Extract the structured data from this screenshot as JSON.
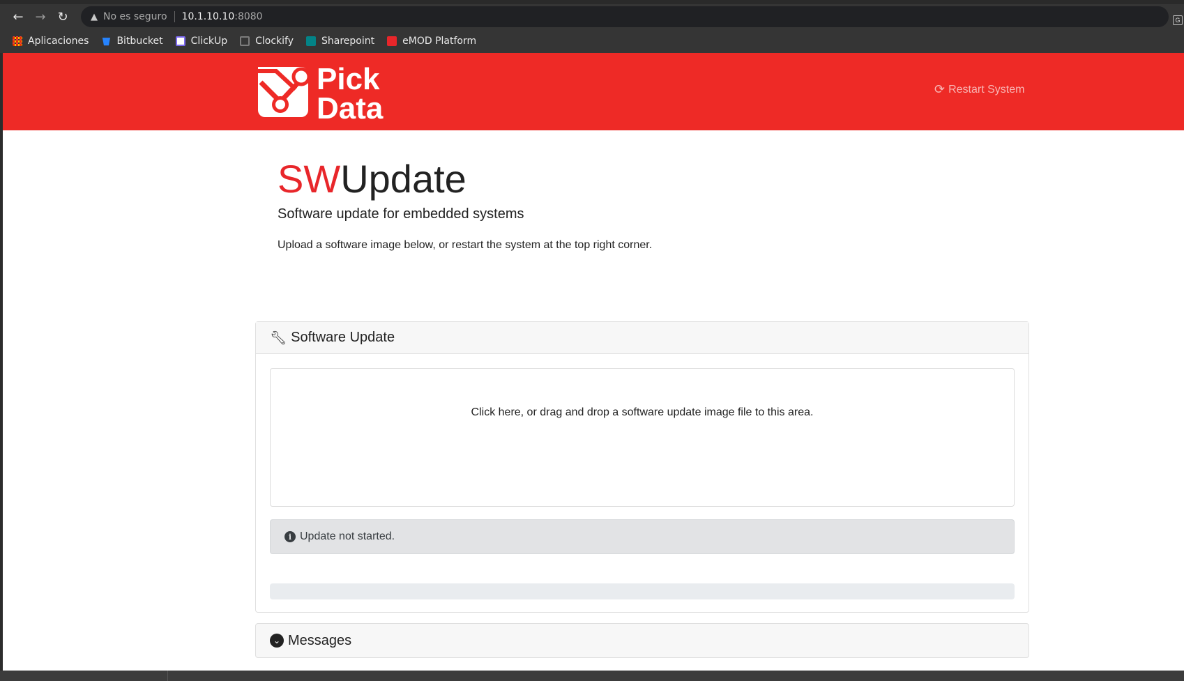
{
  "browser": {
    "security_label": "No es seguro",
    "url_host": "10.1.10.10",
    "url_port": ":8080",
    "bookmarks": [
      {
        "label": "Aplicaciones",
        "icon": "apps-grid-icon"
      },
      {
        "label": "Bitbucket",
        "icon": "bitbucket-icon"
      },
      {
        "label": "ClickUp",
        "icon": "clickup-icon"
      },
      {
        "label": "Clockify",
        "icon": "clockify-icon"
      },
      {
        "label": "Sharepoint",
        "icon": "sharepoint-icon"
      },
      {
        "label": "eMOD Platform",
        "icon": "emod-icon"
      }
    ]
  },
  "header": {
    "brand_color": "#ee2a26",
    "logo_line1": "Pick",
    "logo_line2": "Data",
    "restart_label": "Restart System"
  },
  "hero": {
    "title_accent": "SW",
    "title_rest": "Update",
    "subtitle": "Software update for embedded systems",
    "description": "Upload a software image below, or restart the system at the top right corner."
  },
  "update_card": {
    "title": "Software Update",
    "dropzone_text": "Click here, or drag and drop a software update image file to this area.",
    "status_text": "Update not started.",
    "progress": 0
  },
  "messages_card": {
    "title": "Messages"
  }
}
